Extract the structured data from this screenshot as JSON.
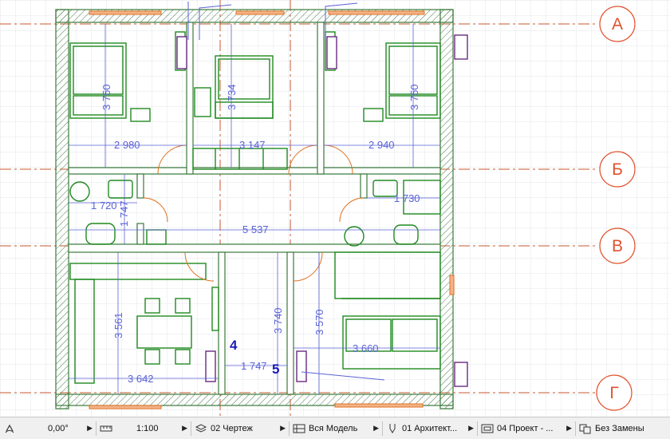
{
  "axes": [
    {
      "label": "А"
    },
    {
      "label": "Б"
    },
    {
      "label": "В"
    },
    {
      "label": "Г"
    }
  ],
  "dimensions": {
    "d1": "3 750",
    "d2": "3 734",
    "d3": "3 750",
    "d4": "2 980",
    "d5": "3 147",
    "d6": "2 940",
    "d7": "1 720",
    "d8": "1 747",
    "d9": "1 730",
    "d10": "5 537",
    "d11": "3 561",
    "d12": "3 740",
    "d13": "3 570",
    "d14": "3 660",
    "d15": "3 642",
    "d16": "1 747"
  },
  "markers": {
    "m1": "4",
    "m2": "5"
  },
  "statusbar": {
    "angle": "0,00°",
    "scale": "1:100",
    "layer": "02 Чертеж",
    "model": "Вся Модель",
    "pen_set": "01 Архитект...",
    "view": "04 Проект - ...",
    "override": "Без Замены"
  },
  "colors": {
    "wall": "#3a7a3a",
    "furniture": "#1f8a1f",
    "axis": "#e0522e",
    "dimension": "#5a62d6",
    "door": "#e0701e"
  }
}
